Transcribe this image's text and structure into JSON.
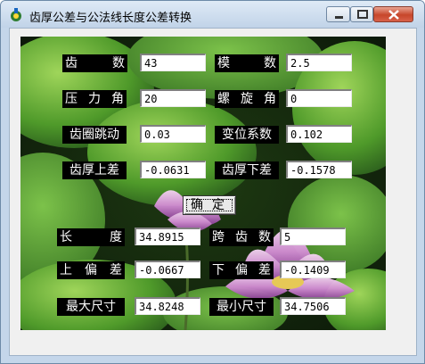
{
  "window": {
    "title": "齿厚公差与公法线长度公差转换",
    "icon": "gear-app-icon"
  },
  "title_controls": {
    "minimize": "minimize-icon",
    "maximize": "maximize-icon",
    "close": "close-icon"
  },
  "inputs": {
    "teeth": {
      "label": [
        "齿",
        "数"
      ],
      "value": "43"
    },
    "module": {
      "label": [
        "模",
        "数"
      ],
      "value": "2.5"
    },
    "pressure_angle": {
      "label": [
        "压",
        "力",
        "角"
      ],
      "value": "20"
    },
    "helix_angle": {
      "label": [
        "螺",
        "旋",
        "角"
      ],
      "value": "0"
    },
    "runout": {
      "label": [
        "齿圈跳动"
      ],
      "value": "0.03"
    },
    "shift_coef": {
      "label": [
        "变位系数"
      ],
      "value": "0.102"
    },
    "thickness_upper": {
      "label": [
        "齿厚上差"
      ],
      "value": "-0.0631"
    },
    "thickness_lower": {
      "label": [
        "齿厚下差"
      ],
      "value": "-0.1578"
    }
  },
  "confirm_button": {
    "label": "确定"
  },
  "results": {
    "length": {
      "label": [
        "长",
        "度"
      ],
      "value": "34.8915"
    },
    "span_teeth": {
      "label": [
        "跨",
        "齿",
        "数"
      ],
      "value": "5"
    },
    "upper_dev": {
      "label": [
        "上",
        "偏",
        "差"
      ],
      "value": "-0.0667"
    },
    "lower_dev": {
      "label": [
        "下",
        "偏",
        "差"
      ],
      "value": "-0.1409"
    },
    "max_size": {
      "label": [
        "最大尺寸"
      ],
      "value": "34.8248"
    },
    "min_size": {
      "label": [
        "最小尺寸"
      ],
      "value": "34.7506"
    }
  }
}
